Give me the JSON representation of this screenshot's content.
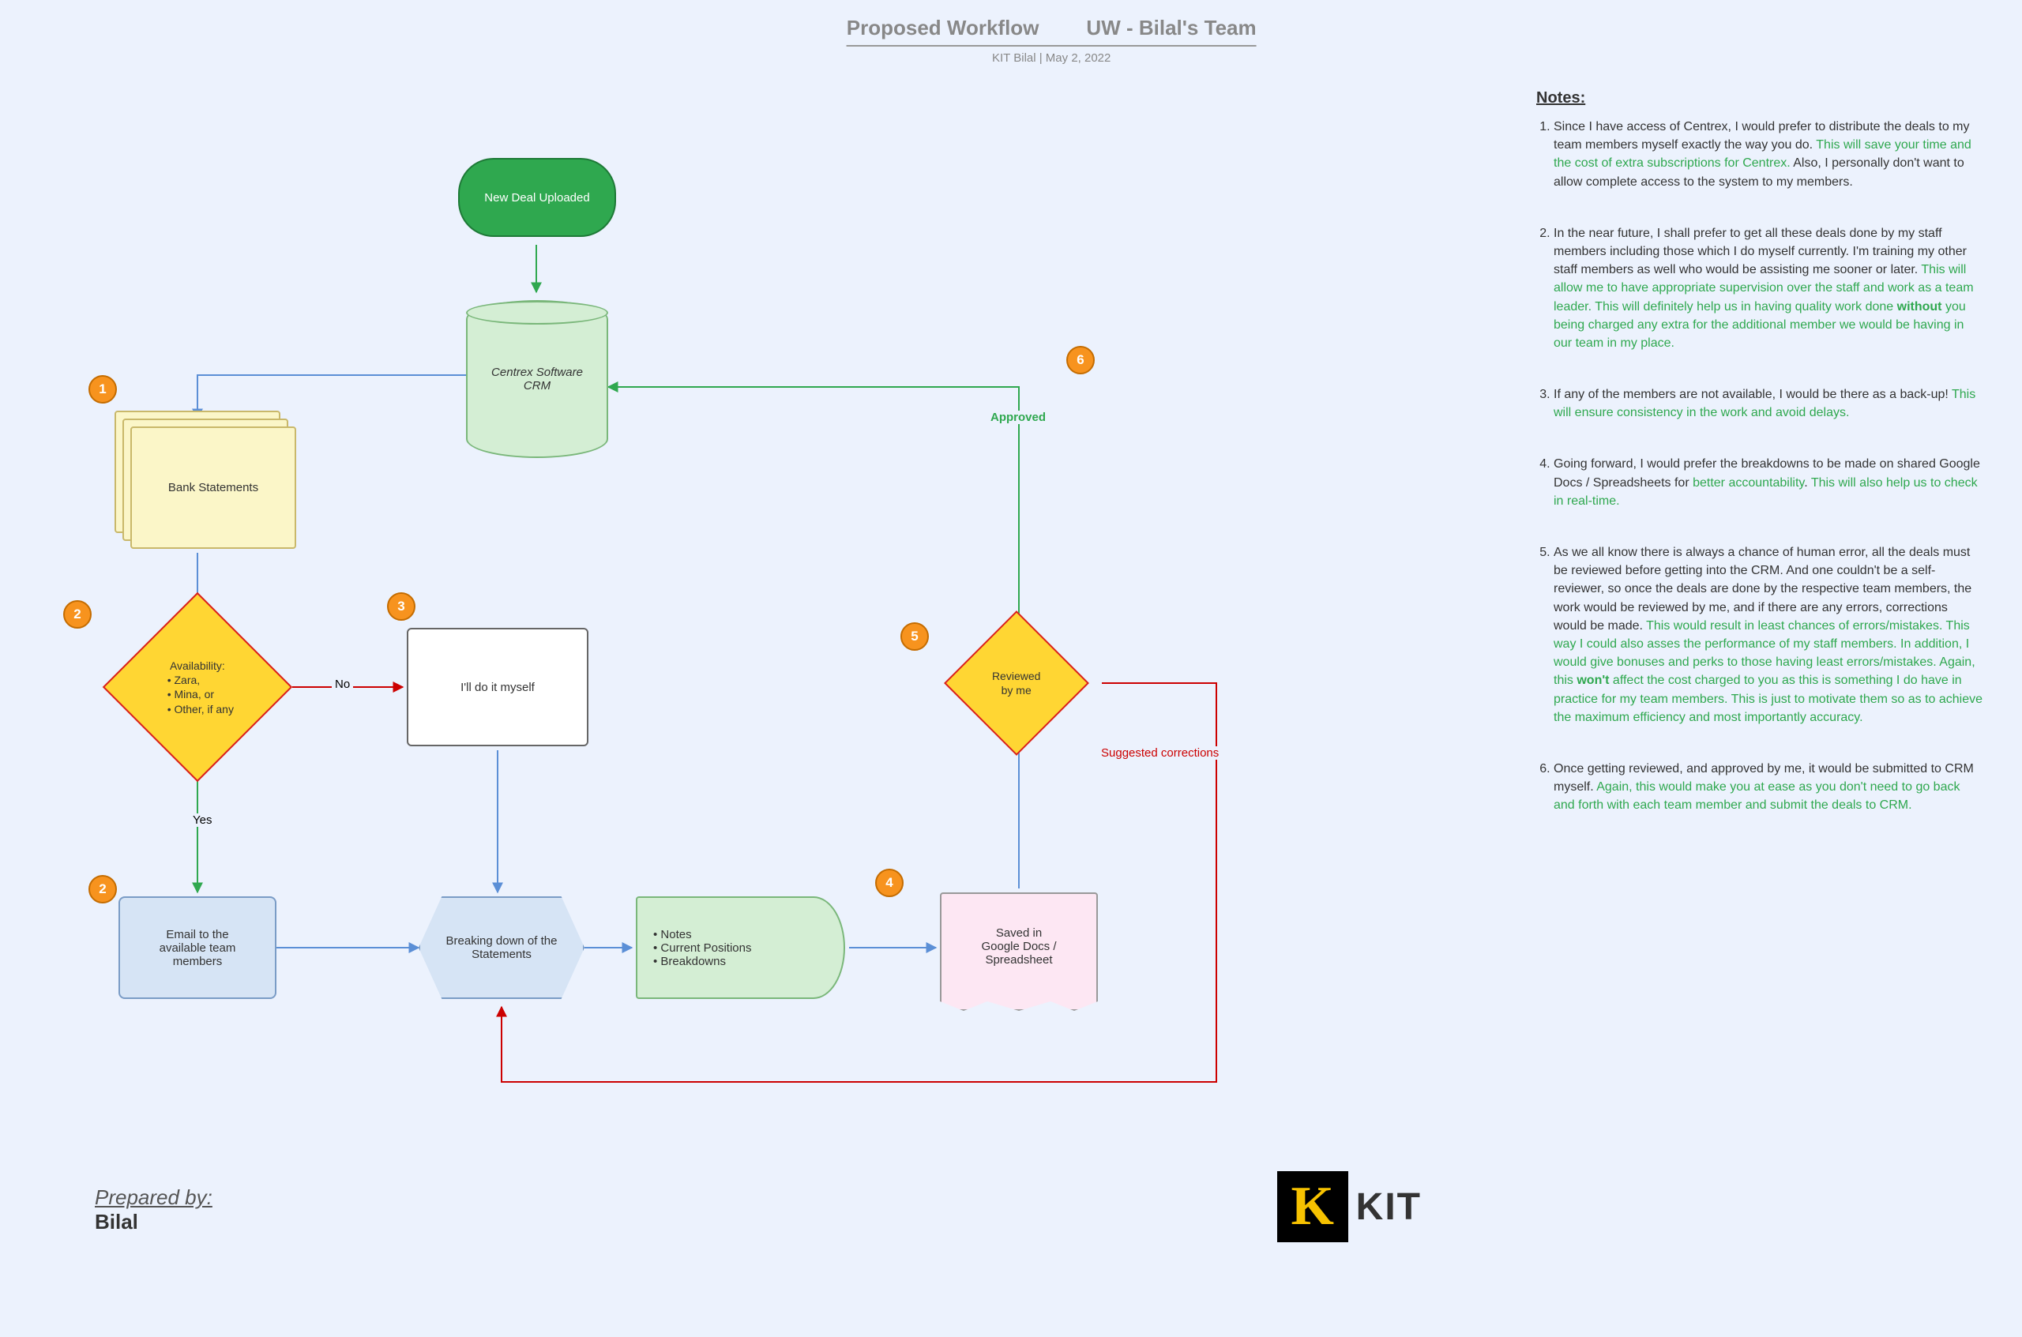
{
  "header": {
    "title_left": "Proposed Workflow",
    "title_right": "UW - Bilal's Team",
    "subtitle": "KIT Bilal  |  May 2, 2022"
  },
  "nodes": {
    "new_deal": "New Deal Uploaded",
    "crm_line1": "Centrex Software",
    "crm_line2": "CRM",
    "bank_statements": "Bank Statements",
    "availability_title": "Availability:",
    "availability_b1": "• Zara,",
    "availability_b2": "• Mina, or",
    "availability_b3": "• Other, if any",
    "do_myself": "I'll do it myself",
    "email_team_l1": "Email to the",
    "email_team_l2": "available team",
    "email_team_l3": "members",
    "breaking_l1": "Breaking down of the",
    "breaking_l2": "Statements",
    "notes_b1": "• Notes",
    "notes_b2": "• Current Positions",
    "notes_b3": "• Breakdowns",
    "saved_l1": "Saved in",
    "saved_l2": "Google Docs /",
    "saved_l3": "Spreadsheet",
    "reviewed_l1": "Reviewed",
    "reviewed_l2": "by me"
  },
  "edge_labels": {
    "yes": "Yes",
    "no": "No",
    "approved": "Approved",
    "suggested": "Suggested corrections"
  },
  "badges": {
    "b1": "1",
    "b2a": "2",
    "b2b": "2",
    "b3": "3",
    "b4": "4",
    "b5": "5",
    "b6": "6"
  },
  "notes": {
    "title": "Notes:",
    "n1_a": "Since I have access of Centrex, I would prefer to distribute the deals to my team members myself exactly the way you do. ",
    "n1_g": "This will save your time and the cost of extra subscriptions for Centrex.",
    "n1_b": " Also, I personally don't want to allow complete access to the system to my members.",
    "n2_a": "In the near future, I shall prefer to get all these deals done by my staff members including those which I do myself currently. I'm training my other staff members as well who would be assisting me sooner or later. ",
    "n2_g1": "This will allow me to have appropriate supervision over the staff and work as a team leader. This will definitely help us in having quality work done ",
    "n2_bold": "without",
    "n2_g2": " you being charged any extra for the additional member we would be having in our team in my place.",
    "n3_a": "If any of the members are not available, I would be there as a back-up! ",
    "n3_g": "This will ensure consistency in the work and avoid delays.",
    "n4_a": "Going forward, I would prefer the breakdowns to be made on shared Google Docs / Spreadsheets for ",
    "n4_g1": "better accountability",
    "n4_b": ". ",
    "n4_g2": "This will also help us to check in real-time.",
    "n5_a": "As we all know there is always a chance of human error, all the deals must be reviewed before getting into the CRM. And one couldn't be a self-reviewer, so once the deals are done by the respective team members, the work would be reviewed by me, and if there are any errors, corrections would be made. ",
    "n5_g1": "This would result in least chances of errors/mistakes. This way I could also asses the performance of my staff members. In addition, I would give bonuses and perks to those having least errors/mistakes. Again, this ",
    "n5_bold": "won't",
    "n5_g2": " affect the cost charged to you as this is something I do have in practice for my team members. This is just to motivate them so as to achieve the maximum efficiency and most importantly accuracy.",
    "n6_a": "Once getting reviewed, and approved by me, it would be submitted to CRM myself. ",
    "n6_g": "Again, this would make you at ease as you don't need to go back and forth with each team member and submit the deals to CRM."
  },
  "prepared": {
    "label": "Prepared by:",
    "name": "Bilal"
  },
  "logo": {
    "k": "K",
    "text": "KIT"
  }
}
